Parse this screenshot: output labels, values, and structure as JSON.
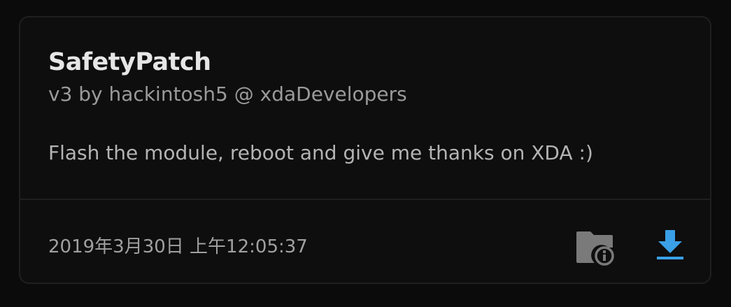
{
  "module": {
    "name": "SafetyPatch",
    "version_author": "v3 by hackintosh5 @ xdaDevelopers",
    "description": "Flash the module, reboot and give me thanks on XDA :)",
    "date": "2019年3月30日 上午12:05:37"
  },
  "actions": {
    "info_icon": "folder-info-icon",
    "download_icon": "download-icon"
  },
  "colors": {
    "background": "#0b0b0b",
    "card": "#0e0e0e",
    "accent": "#3aa0e8",
    "icon_gray": "#7a7a7a"
  }
}
